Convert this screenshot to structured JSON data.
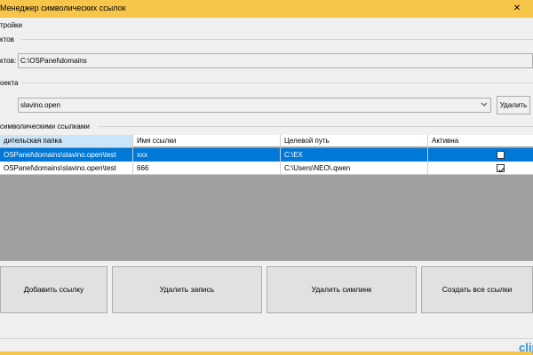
{
  "window": {
    "title": "Менеджер символических ссылок",
    "close_glyph": "✕",
    "colors": {
      "titlebar": "#f7c54a",
      "selection": "#0078d7",
      "grid_empty": "#a0a0a0"
    }
  },
  "menu": {
    "settings": "тройки"
  },
  "folder_section": {
    "label": "ктов",
    "field_label": "ктов:",
    "path_value": "C:\\OSPanel\\domains"
  },
  "project_section": {
    "label": "оекта",
    "selected": "slavino.open",
    "delete_label": "Удалить"
  },
  "links_section": {
    "label": "символическими ссылками",
    "columns": [
      "дительская папка",
      "Имя ссылки",
      "Целевой путь",
      "Активна"
    ],
    "rows": [
      {
        "parent": "OSPanel\\domains\\slavino.open\\test",
        "name": "xxx",
        "target": "C:\\EX",
        "active": false,
        "selected": true
      },
      {
        "parent": "OSPanel\\domains\\slavino.open\\test",
        "name": "666",
        "target": "C:\\Users\\NEO\\.qwen",
        "active": true,
        "selected": false
      }
    ]
  },
  "actions": {
    "add": "Добавить ссылку",
    "delete_record": "Удалить запись",
    "delete_symlink": "Удалить симлинк",
    "create_all": "Создать все ссылки"
  },
  "watermark": {
    "text": "clip"
  }
}
